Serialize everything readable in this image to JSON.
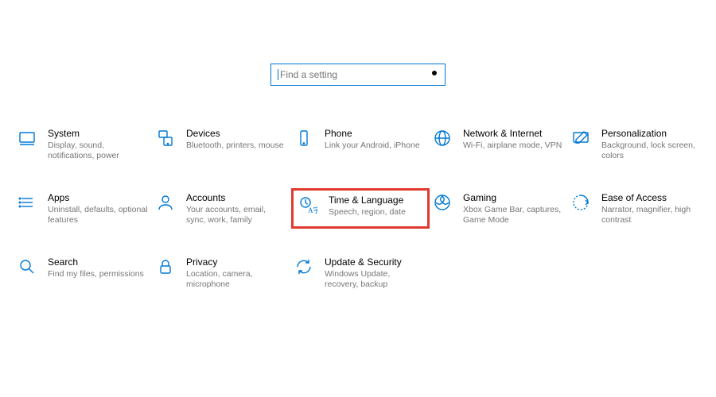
{
  "search": {
    "placeholder": "Find a setting"
  },
  "tiles": {
    "system": {
      "title": "System",
      "desc": "Display, sound, notifications, power"
    },
    "devices": {
      "title": "Devices",
      "desc": "Bluetooth, printers, mouse"
    },
    "phone": {
      "title": "Phone",
      "desc": "Link your Android, iPhone"
    },
    "network": {
      "title": "Network & Internet",
      "desc": "Wi-Fi, airplane mode, VPN"
    },
    "personalization": {
      "title": "Personalization",
      "desc": "Background, lock screen, colors"
    },
    "apps": {
      "title": "Apps",
      "desc": "Uninstall, defaults, optional features"
    },
    "accounts": {
      "title": "Accounts",
      "desc": "Your accounts, email, sync, work, family"
    },
    "time": {
      "title": "Time & Language",
      "desc": "Speech, region, date"
    },
    "gaming": {
      "title": "Gaming",
      "desc": "Xbox Game Bar, captures, Game Mode"
    },
    "ease": {
      "title": "Ease of Access",
      "desc": "Narrator, magnifier, high contrast"
    },
    "search": {
      "title": "Search",
      "desc": "Find my files, permissions"
    },
    "privacy": {
      "title": "Privacy",
      "desc": "Location, camera, microphone"
    },
    "update": {
      "title": "Update & Security",
      "desc": "Windows Update, recovery, backup"
    }
  },
  "highlighted": "time"
}
